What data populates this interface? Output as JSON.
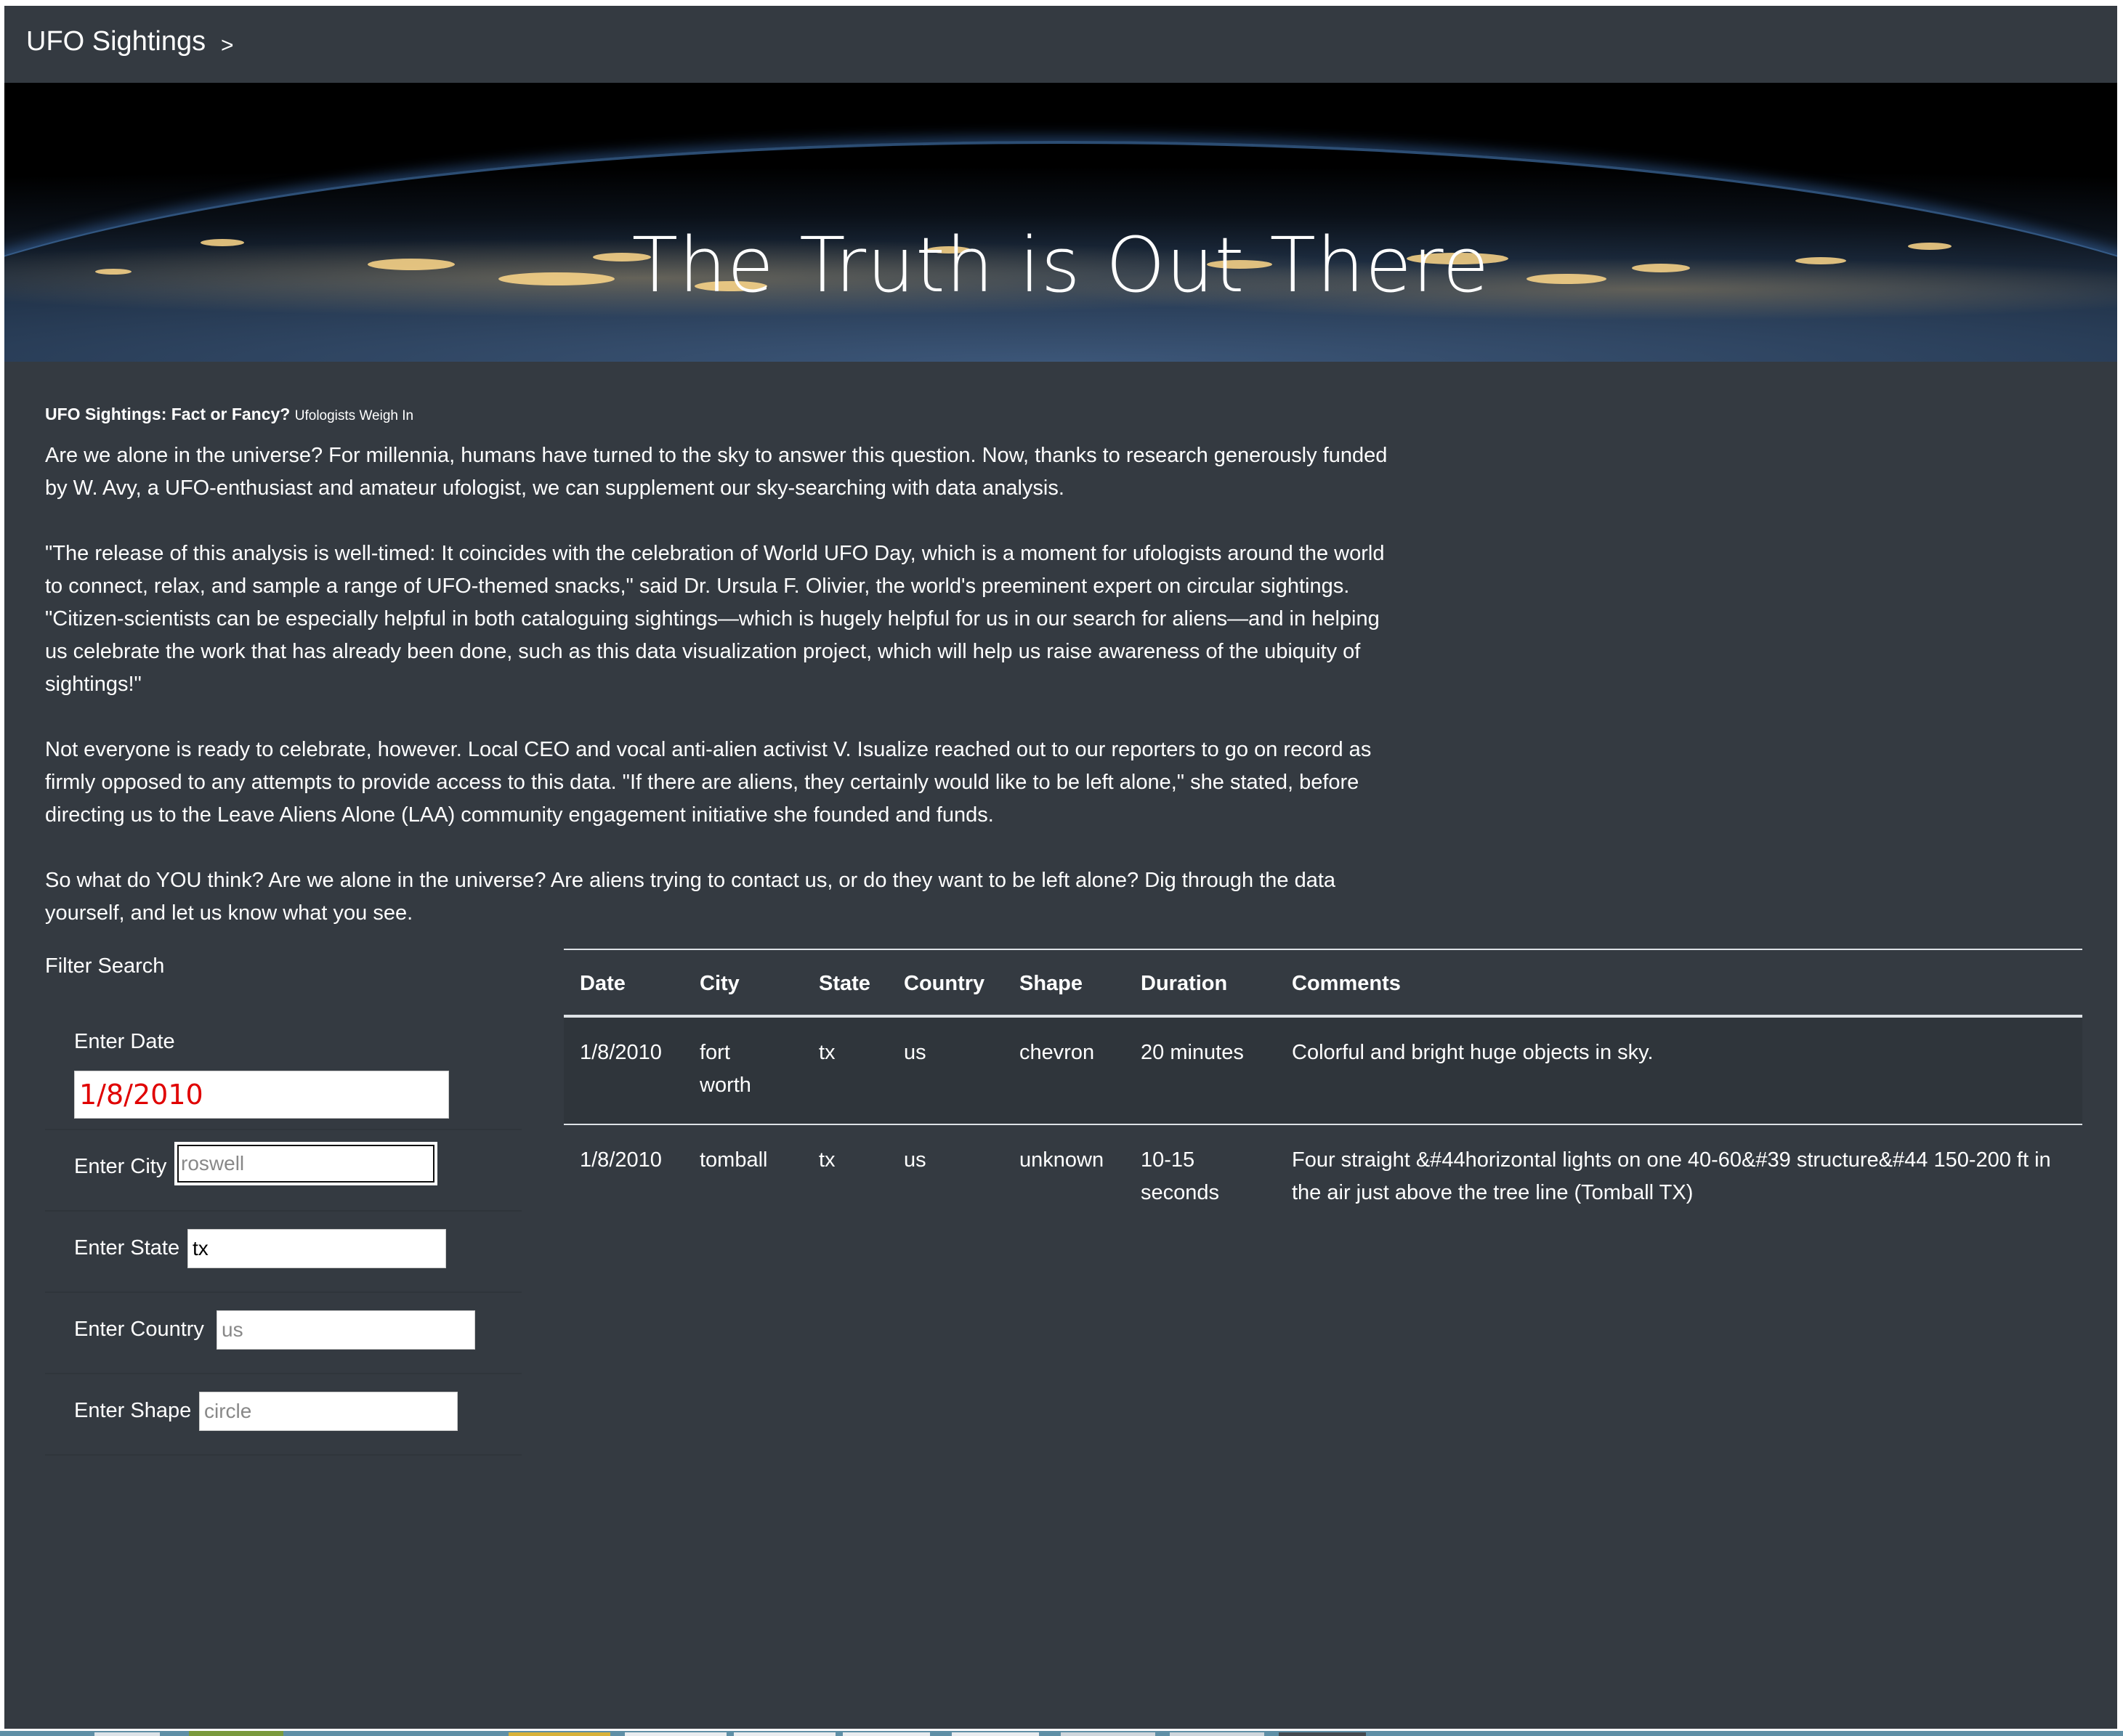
{
  "navbar": {
    "brand": "UFO Sightings",
    "toggle": ">"
  },
  "hero": {
    "title": "The Truth is Out There"
  },
  "article": {
    "heading": "UFO Sightings: Fact or Fancy?",
    "subheading": "Ufologists Weigh In",
    "paragraphs": [
      "Are we alone in the universe? For millennia, humans have turned to the sky to answer this question. Now, thanks to research generously funded by W. Avy, a UFO-enthusiast and amateur ufologist, we can supplement our sky-searching with data analysis.",
      "\"The release of this analysis is well-timed: It coincides with the celebration of World UFO Day, which is a moment for ufologists around the world to connect, relax, and sample a range of UFO-themed snacks,\" said Dr. Ursula F. Olivier, the world's preeminent expert on circular sightings. \"Citizen-scientists can be especially helpful in both cataloguing sightings—which is hugely helpful for us in our search for aliens—and in helping us celebrate the work that has already been done, such as this data visualization project, which will help us raise awareness of the ubiquity of sightings!\"",
      "Not everyone is ready to celebrate, however. Local CEO and vocal anti-alien activist V. Isualize reached out to our reporters to go on record as firmly opposed to any attempts to provide access to this data. \"If there are aliens, they certainly would like to be left alone,\" she stated, before directing us to the Leave Aliens Alone (LAA) community engagement initiative she founded and funds.",
      "So what do YOU think? Are we alone in the universe? Are aliens trying to contact us, or do they want to be left alone? Dig through the data yourself, and let us know what you see."
    ]
  },
  "filter": {
    "title": "Filter Search",
    "date": {
      "label": "Enter Date",
      "value": "1/8/2010",
      "placeholder": ""
    },
    "city": {
      "label": "Enter City",
      "value": "",
      "placeholder": "roswell"
    },
    "state": {
      "label": "Enter State",
      "value": "tx",
      "placeholder": ""
    },
    "country": {
      "label": "Enter Country",
      "value": "",
      "placeholder": "us"
    },
    "shape": {
      "label": "Enter Shape",
      "value": "",
      "placeholder": "circle"
    },
    "date_value_color": "#e00000"
  },
  "table": {
    "headers": [
      "Date",
      "City",
      "State",
      "Country",
      "Shape",
      "Duration",
      "Comments"
    ],
    "rows": [
      [
        "1/8/2010",
        "fort worth",
        "tx",
        "us",
        "chevron",
        "20 minutes",
        "Colorful and bright huge objects in sky."
      ],
      [
        "1/8/2010",
        "tomball",
        "tx",
        "us",
        "unknown",
        "10-15 seconds",
        "Four straight &#44horizontal lights on one 40-60&#39 structure&#44 150-200 ft in the air just above the tree line (Tomball TX)"
      ]
    ]
  },
  "colors": {
    "page_bg": "#343a41",
    "table_stripe": "#2f353b",
    "rule": "#dee2e6"
  }
}
